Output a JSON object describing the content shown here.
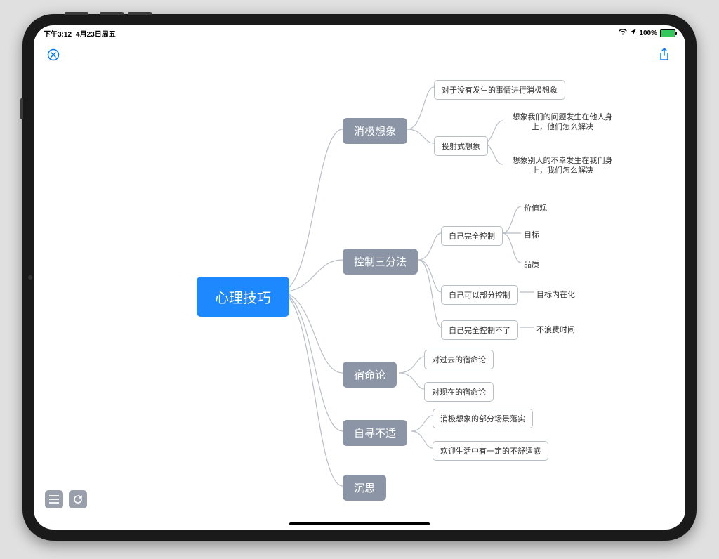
{
  "status": {
    "time": "下午3:12",
    "date": "4月23日周五",
    "battery_pct": "100%",
    "signal_glyph": "▰",
    "location_glyph": "➤",
    "wifi_glyph": "▾"
  },
  "toolbar": {
    "close_label": "Close",
    "share_label": "Share",
    "list_label": "Outline",
    "refresh_label": "Sync"
  },
  "mindmap": {
    "root": "心理技巧",
    "branches": [
      {
        "label": "消极想象",
        "children": [
          {
            "label": "对于没有发生的事情进行消极想象"
          },
          {
            "label": "投射式想象",
            "children": [
              {
                "label": "想象我们的问题发生在他人身上，他们怎么解决"
              },
              {
                "label": "想象别人的不幸发生在我们身上，我们怎么解决"
              }
            ]
          }
        ]
      },
      {
        "label": "控制三分法",
        "children": [
          {
            "label": "自己完全控制",
            "children": [
              {
                "label": "价值观"
              },
              {
                "label": "目标"
              },
              {
                "label": "品质"
              }
            ]
          },
          {
            "label": "自己可以部分控制",
            "children": [
              {
                "label": "目标内在化"
              }
            ]
          },
          {
            "label": "自己完全控制不了",
            "children": [
              {
                "label": "不浪费时间"
              }
            ]
          }
        ]
      },
      {
        "label": "宿命论",
        "children": [
          {
            "label": "对过去的宿命论"
          },
          {
            "label": "对现在的宿命论"
          }
        ]
      },
      {
        "label": "自寻不适",
        "children": [
          {
            "label": "消极想象的部分场景落实"
          },
          {
            "label": "欢迎生活中有一定的不舒适感"
          }
        ]
      },
      {
        "label": "沉思"
      }
    ]
  }
}
